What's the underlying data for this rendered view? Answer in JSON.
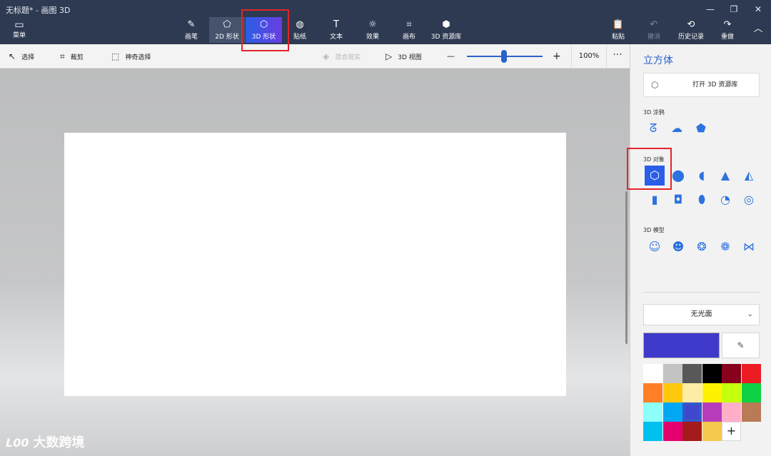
{
  "window": {
    "title": "无标题* - 画图 3D",
    "minimize": "—",
    "restore": "❐",
    "close": "✕"
  },
  "ribbon": {
    "menu": {
      "label": "菜单",
      "icon": "folder-icon",
      "glyph": "▭"
    },
    "tools": [
      {
        "label": "画笔",
        "icon": "brush-icon",
        "glyph": "✎"
      },
      {
        "label": "2D 形状",
        "icon": "2d-shapes-icon",
        "glyph": "⬠"
      },
      {
        "label": "3D 形状",
        "icon": "cube-icon",
        "glyph": "⬡"
      },
      {
        "label": "贴纸",
        "icon": "sticker-icon",
        "glyph": "◍"
      },
      {
        "label": "文本",
        "icon": "text-icon",
        "glyph": "T"
      },
      {
        "label": "效果",
        "icon": "sun-icon",
        "glyph": "☼"
      },
      {
        "label": "画布",
        "icon": "canvas-icon",
        "glyph": "⌗"
      },
      {
        "label": "3D 资源库",
        "icon": "3d-library-icon",
        "glyph": "⬢"
      }
    ],
    "actions": [
      {
        "label": "粘贴",
        "icon": "paste-icon",
        "glyph": "📋"
      },
      {
        "label": "撤消",
        "icon": "undo-icon",
        "glyph": "↶"
      },
      {
        "label": "历史记录",
        "icon": "history-icon",
        "glyph": "⟲"
      },
      {
        "label": "重做",
        "icon": "redo-icon",
        "glyph": "↷"
      }
    ],
    "collapse_glyph": "︿"
  },
  "toolbar": {
    "select": {
      "label": "选择",
      "glyph": "↖"
    },
    "crop": {
      "label": "裁剪",
      "glyph": "⌗"
    },
    "magic_select": {
      "label": "神奇选择",
      "glyph": "⬚"
    },
    "mixed_reality": {
      "label": "混合现实",
      "glyph": "◈"
    },
    "view_3d": {
      "label": "3D 视图",
      "glyph": "▷"
    },
    "zoom_minus": "—",
    "zoom_plus": "+",
    "zoom_value": "100%",
    "zoom_level_fraction": 0.5,
    "more": "···"
  },
  "panel": {
    "title": "立方体",
    "open_library": {
      "label": "打开 3D 资源库",
      "glyph": "⬡"
    },
    "doodle_title": "3D 涂鸦",
    "doodles": [
      {
        "name": "sharp-doodle-icon",
        "glyph": "ᘔ"
      },
      {
        "name": "soft-doodle-icon",
        "glyph": "☁"
      },
      {
        "name": "tube-doodle-icon",
        "glyph": "⬟"
      }
    ],
    "objects_title": "3D 对象",
    "objects": [
      {
        "name": "cube-icon",
        "glyph": "⬡"
      },
      {
        "name": "sphere-icon",
        "glyph": "⬤"
      },
      {
        "name": "hemisphere-icon",
        "glyph": "◖"
      },
      {
        "name": "cone-icon",
        "glyph": "▲"
      },
      {
        "name": "pyramid-icon",
        "glyph": "◭"
      },
      {
        "name": "cylinder-icon",
        "glyph": "▮"
      },
      {
        "name": "tube-icon",
        "glyph": "◘"
      },
      {
        "name": "capsule-icon",
        "glyph": "⬮"
      },
      {
        "name": "bent-tube-icon",
        "glyph": "◔"
      },
      {
        "name": "donut-icon",
        "glyph": "◎"
      }
    ],
    "models_title": "3D 模型",
    "models": [
      {
        "name": "man-model-icon",
        "glyph": "☺"
      },
      {
        "name": "woman-model-icon",
        "glyph": "☻"
      },
      {
        "name": "dog-model-icon",
        "glyph": "❂"
      },
      {
        "name": "cat-model-icon",
        "glyph": "❁"
      },
      {
        "name": "fish-model-icon",
        "glyph": "⋈"
      }
    ],
    "finish": {
      "value": "无光面",
      "chevron": "⌄"
    },
    "current_color": "#3f3ac9",
    "eyedropper_glyph": "✎",
    "palette": [
      "#ffffff",
      "#c3c3c3",
      "#585858",
      "#000000",
      "#88001b",
      "#ec1c24",
      "#ff7f27",
      "#ffc90e",
      "#fdeca6",
      "#fff200",
      "#c4ff0e",
      "#0ed145",
      "#8cfffb",
      "#00a8f3",
      "#3f48cc",
      "#b83dba",
      "#ffaec8",
      "#b97a56",
      "#00c0f0",
      "#e5006e",
      "#a31b1b",
      "#f2c94c"
    ],
    "add_color": "+"
  },
  "watermark": {
    "logo": "L00",
    "text": "大数跨境"
  }
}
